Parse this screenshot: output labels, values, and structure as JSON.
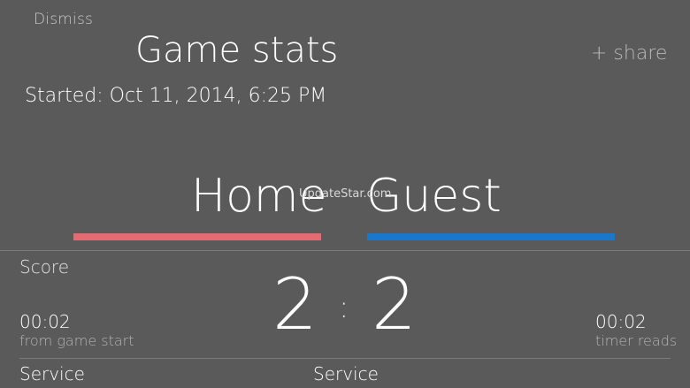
{
  "header": {
    "dismiss_label": "Dismiss",
    "title": "Game stats",
    "share_label": "+ share",
    "started": "Started: Oct 11, 2014, 6:25 PM"
  },
  "teams": {
    "home": {
      "name": "Home",
      "color": "#e46b71"
    },
    "guest": {
      "name": "Guest",
      "color": "#1a78cc"
    }
  },
  "watermark": "UpdateStar.com",
  "score": {
    "label": "Score",
    "home": "2",
    "separator": ":",
    "guest": "2",
    "elapsed_left": "00:02",
    "elapsed_left_caption": "from game start",
    "elapsed_right": "00:02",
    "elapsed_right_caption": "timer reads"
  },
  "service": {
    "left_label": "Service",
    "center_label": "Service"
  }
}
